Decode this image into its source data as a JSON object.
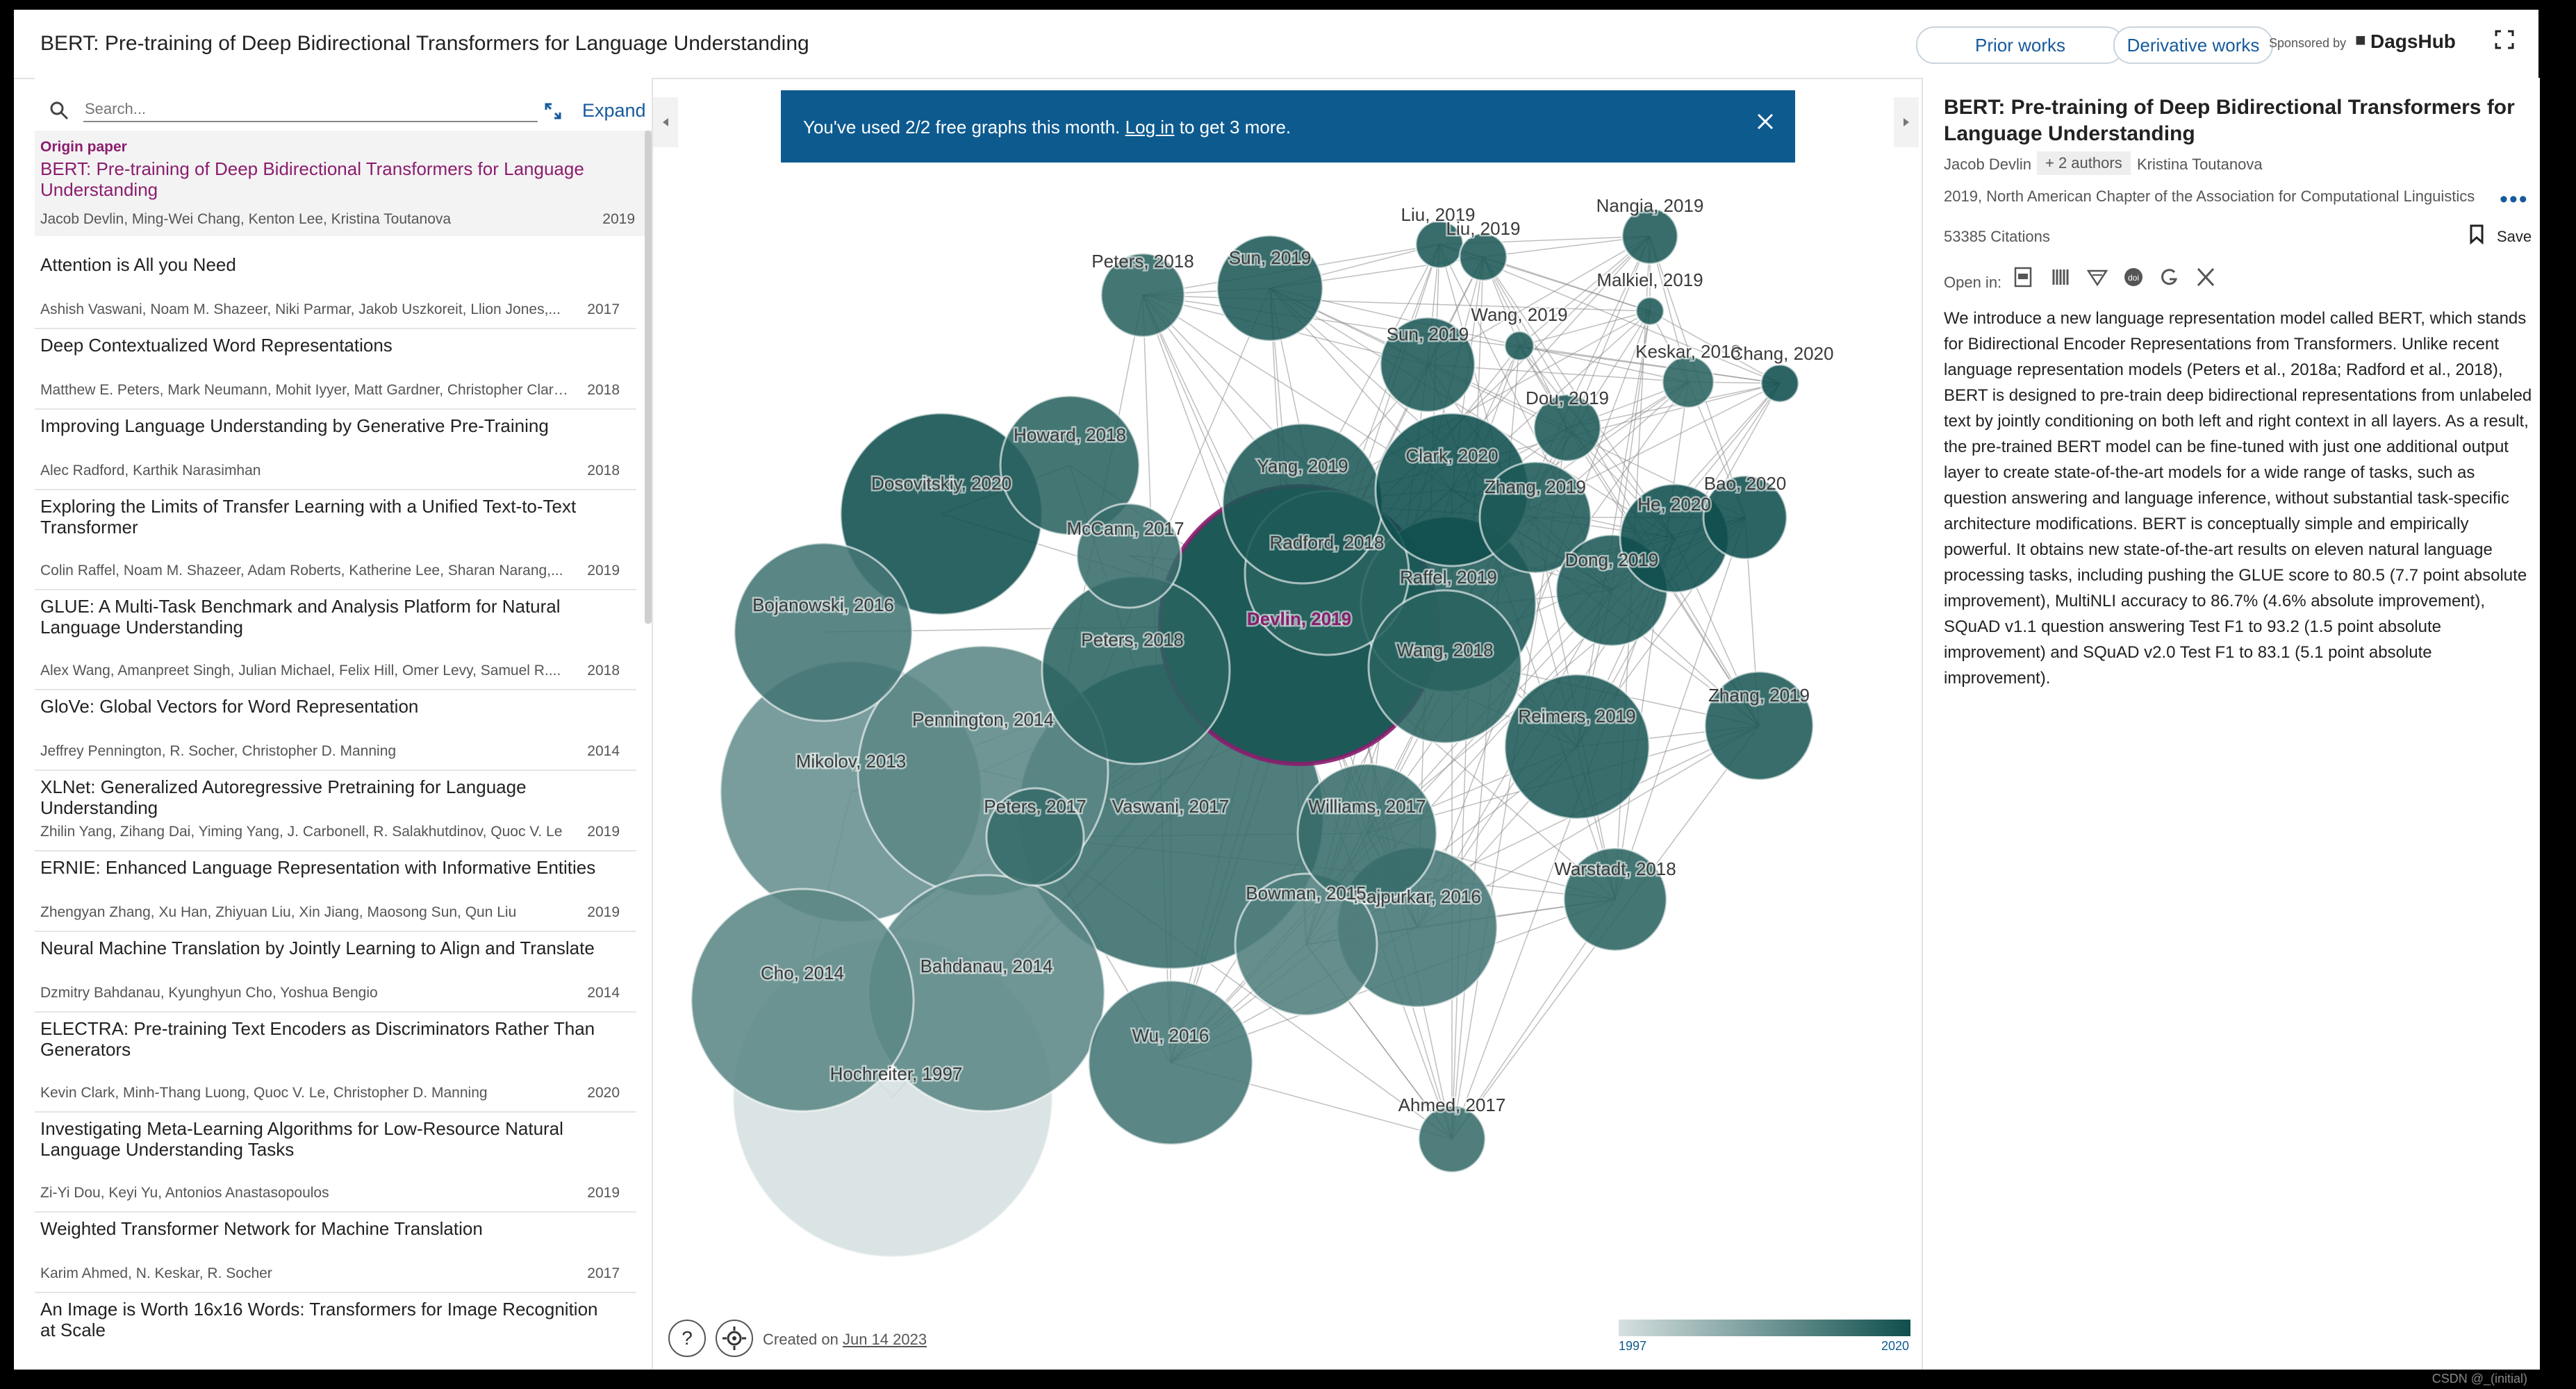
{
  "app": {
    "title": "BERT: Pre-training of Deep Bidirectional Transformers for Language Understanding",
    "prior_works": "Prior works",
    "derivative_works": "Derivative works",
    "sponsored_by": "Sponsored by",
    "sponsor_name": "DagsHub"
  },
  "search": {
    "placeholder": "Search...",
    "expand_label": "Expand"
  },
  "origin": {
    "tag": "Origin paper",
    "title": "BERT: Pre-training of Deep Bidirectional Transformers for Language Understanding",
    "authors": "Jacob Devlin, Ming-Wei Chang, Kenton Lee, Kristina Toutanova",
    "year": "2019"
  },
  "papers": [
    {
      "title": "Attention is All you Need",
      "authors": "Ashish Vaswani, Noam M. Shazeer, Niki Parmar, Jakob Uszkoreit, Llion Jones,...",
      "year": "2017"
    },
    {
      "title": "Deep Contextualized Word Representations",
      "authors": "Matthew E. Peters, Mark Neumann, Mohit Iyyer, Matt Gardner, Christopher Clark,...",
      "year": "2018"
    },
    {
      "title": "Improving Language Understanding by Generative Pre-Training",
      "authors": "Alec Radford, Karthik Narasimhan",
      "year": "2018"
    },
    {
      "title": "Exploring the Limits of Transfer Learning with a Unified Text-to-Text Transformer",
      "authors": "Colin Raffel, Noam M. Shazeer, Adam Roberts, Katherine Lee, Sharan Narang,...",
      "year": "2019"
    },
    {
      "title": "GLUE: A Multi-Task Benchmark and Analysis Platform for Natural Language Understanding",
      "authors": "Alex Wang, Amanpreet Singh, Julian Michael, Felix Hill, Omer Levy, Samuel R....",
      "year": "2018"
    },
    {
      "title": "GloVe: Global Vectors for Word Representation",
      "authors": "Jeffrey Pennington, R. Socher, Christopher D. Manning",
      "year": "2014"
    },
    {
      "title": "XLNet: Generalized Autoregressive Pretraining for Language Understanding",
      "authors": "Zhilin Yang, Zihang Dai, Yiming Yang, J. Carbonell, R. Salakhutdinov, Quoc V. Le",
      "year": "2019"
    },
    {
      "title": "ERNIE: Enhanced Language Representation with Informative Entities",
      "authors": "Zhengyan Zhang, Xu Han, Zhiyuan Liu, Xin Jiang, Maosong Sun, Qun Liu",
      "year": "2019"
    },
    {
      "title": "Neural Machine Translation by Jointly Learning to Align and Translate",
      "authors": "Dzmitry Bahdanau, Kyunghyun Cho, Yoshua Bengio",
      "year": "2014"
    },
    {
      "title": "ELECTRA: Pre-training Text Encoders as Discriminators Rather Than Generators",
      "authors": "Kevin Clark, Minh-Thang Luong, Quoc V. Le, Christopher D. Manning",
      "year": "2020"
    },
    {
      "title": "Investigating Meta-Learning Algorithms for Low-Resource Natural Language Understanding Tasks",
      "authors": "Zi-Yi Dou, Keyi Yu, Antonios Anastasopoulos",
      "year": "2019"
    },
    {
      "title": "Weighted Transformer Network for Machine Translation",
      "authors": "Karim Ahmed, N. Keskar, R. Socher",
      "year": "2017"
    },
    {
      "title": "An Image is Worth 16x16 Words: Transformers for Image Recognition at Scale",
      "authors": "",
      "year": ""
    }
  ],
  "banner": {
    "text_before": "You've used 2/2 free graphs this month.",
    "link": "Log in",
    "text_after": "to get 3 more."
  },
  "graph": {
    "created_label": "Created on",
    "created_date": "Jun 14 2023",
    "scale_min": "1997",
    "scale_max": "2020",
    "color_old": "#d6e0e0",
    "color_new": "#0f4f4d",
    "origin_ring": "#8b1d6e",
    "nodes": [
      {
        "label": "Devlin, 2019",
        "year": 2019,
        "origin": true
      },
      {
        "label": "Vaswani, 2017",
        "year": 2017
      },
      {
        "label": "Peters, 2018",
        "year": 2018
      },
      {
        "label": "Radford, 2018",
        "year": 2018
      },
      {
        "label": "Raffel, 2019",
        "year": 2019
      },
      {
        "label": "Wang, 2018",
        "year": 2018
      },
      {
        "label": "Pennington, 2014",
        "year": 2014
      },
      {
        "label": "Mikolov, 2013",
        "year": 2013
      },
      {
        "label": "Bahdanau, 2014",
        "year": 2014
      },
      {
        "label": "Cho, 2014",
        "year": 2014
      },
      {
        "label": "Hochreiter, 1997",
        "year": 1997
      },
      {
        "label": "Bojanowski, 2016",
        "year": 2016
      },
      {
        "label": "Dosovitskiy, 2020",
        "year": 2020
      },
      {
        "label": "Howard, 2018",
        "year": 2018
      },
      {
        "label": "McCann, 2017",
        "year": 2017
      },
      {
        "label": "Yang, 2019",
        "year": 2019
      },
      {
        "label": "Clark, 2020",
        "year": 2020
      },
      {
        "label": "Zhang, 2019",
        "year": 2019
      },
      {
        "label": "Dong, 2019",
        "year": 2019
      },
      {
        "label": "He, 2020",
        "year": 2020
      },
      {
        "label": "Bao, 2020",
        "year": 2020
      },
      {
        "label": "Reimers, 2019",
        "year": 2019
      },
      {
        "label": "Zhang, 2019",
        "year": 2019
      },
      {
        "label": "Williams, 2017",
        "year": 2017
      },
      {
        "label": "Rajpurkar, 2016",
        "year": 2016
      },
      {
        "label": "Bowman, 2015",
        "year": 2015
      },
      {
        "label": "Warstadt, 2018",
        "year": 2018
      },
      {
        "label": "Wu, 2016",
        "year": 2016
      },
      {
        "label": "Ahmed, 2017",
        "year": 2017
      },
      {
        "label": "Peters, 2017",
        "year": 2017
      },
      {
        "label": "Peters, 2018",
        "year": 2018
      },
      {
        "label": "Sun, 2019",
        "year": 2019
      },
      {
        "label": "Sun, 2019",
        "year": 2019
      },
      {
        "label": "Liu, 2019",
        "year": 2019
      },
      {
        "label": "Liu, 2019",
        "year": 2019
      },
      {
        "label": "Nangia, 2019",
        "year": 2019
      },
      {
        "label": "Malkiel, 2019",
        "year": 2019
      },
      {
        "label": "Wang, 2019",
        "year": 2019
      },
      {
        "label": "Keskar, 2018",
        "year": 2018
      },
      {
        "label": "Chang, 2020",
        "year": 2020
      },
      {
        "label": "Dou, 2019",
        "year": 2019
      }
    ]
  },
  "detail": {
    "title": "BERT: Pre-training of Deep Bidirectional Transformers for Language Understanding",
    "first_author": "Jacob Devlin",
    "more_authors": "+ 2 authors",
    "last_author": "Kristina Toutanova",
    "venue": "2019, North American Chapter of the Association for Computational Linguistics",
    "more": "•••",
    "citations": "53385 Citations",
    "save_label": "Save",
    "open_in": "Open in:",
    "open_icons": [
      "pdf-icon",
      "semantic-scholar-icon",
      "arxiv-icon",
      "doi-icon",
      "google-scholar-icon",
      "x-icon"
    ],
    "abstract": "We introduce a new language representation model called BERT, which stands for Bidirectional Encoder Representations from Transformers. Unlike recent language representation models (Peters et al., 2018a; Radford et al., 2018), BERT is designed to pre-train deep bidirectional representations from unlabeled text by jointly conditioning on both left and right context in all layers. As a result, the pre-trained BERT model can be fine-tuned with just one additional output layer to create state-of-the-art models for a wide range of tasks, such as question answering and language inference, without substantial task-specific architecture modifications. BERT is conceptually simple and empirically powerful. It obtains new state-of-the-art results on eleven natural language processing tasks, including pushing the GLUE score to 80.5 (7.7 point absolute improvement), MultiNLI accuracy to 86.7% (4.6% absolute improvement), SQuAD v1.1 question answering Test F1 to 93.2 (1.5 point absolute improvement) and SQuAD v2.0 Test F1 to 83.1 (5.1 point absolute improvement)."
  },
  "watermark": "CSDN @_(initial)"
}
